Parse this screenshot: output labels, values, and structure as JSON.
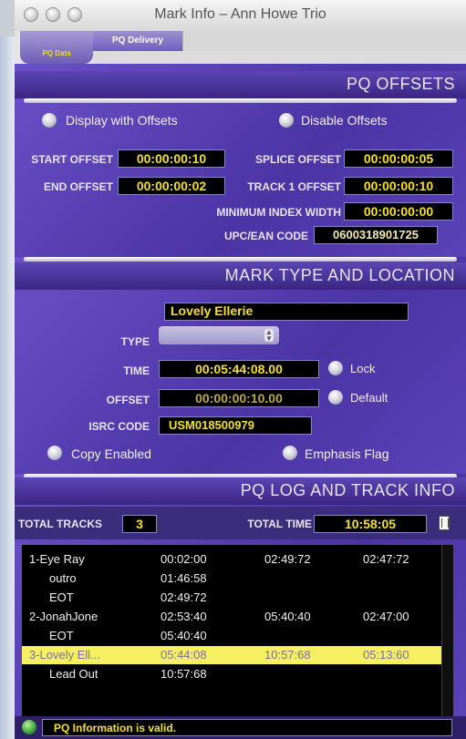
{
  "window": {
    "title": "Mark Info – Ann Howe Trio"
  },
  "tabs": {
    "active": "PQ Data",
    "second": "PQ Delivery"
  },
  "pq_offsets": {
    "header": "PQ OFFSETS",
    "display_with_offsets": "Display with Offsets",
    "disable_offsets": "Disable Offsets",
    "start_offset_label": "START OFFSET",
    "start_offset_value": "00:00:00:10",
    "splice_offset_label": "SPLICE OFFSET",
    "splice_offset_value": "00:00:00:05",
    "end_offset_label": "END OFFSET",
    "end_offset_value": "00:00:00:02",
    "track1_offset_label": "TRACK 1 OFFSET",
    "track1_offset_value": "00:00:00:10",
    "min_index_label": "MINIMUM INDEX WIDTH",
    "min_index_value": "00:00:00:00",
    "upc_label": "UPC/EAN CODE",
    "upc_value": "0600318901725"
  },
  "mark_type": {
    "header": "MARK TYPE AND LOCATION",
    "name": "Lovely Ellerie",
    "type_label": "TYPE",
    "time_label": "TIME",
    "time_value": "00:05:44:08.00",
    "lock_label": "Lock",
    "offset_label": "OFFSET",
    "offset_value": "00:00:00:10.00",
    "default_label": "Default",
    "isrc_label": "ISRC CODE",
    "isrc_value": "USM018500979",
    "copy_enabled": "Copy Enabled",
    "emphasis_flag": "Emphasis Flag"
  },
  "pq_log": {
    "header": "PQ LOG AND TRACK INFO",
    "total_tracks_label": "TOTAL TRACKS",
    "total_tracks_value": "3",
    "total_time_label": "TOTAL TIME",
    "total_time_value": "10:58:05",
    "rows": [
      {
        "c1": "1-Eye Ray",
        "c2": "00:02:00",
        "c3": "02:49:72",
        "c4": "02:47:72",
        "selected": false
      },
      {
        "c1": "outro",
        "c2": "01:46:58",
        "c3": "",
        "c4": "",
        "selected": false
      },
      {
        "c1": "EOT",
        "c2": "02:49:72",
        "c3": "",
        "c4": "",
        "selected": false
      },
      {
        "c1": "2-JonahJone",
        "c2": "02:53:40",
        "c3": "05:40:40",
        "c4": "02:47:00",
        "selected": false
      },
      {
        "c1": "EOT",
        "c2": "05:40:40",
        "c3": "",
        "c4": "",
        "selected": false
      },
      {
        "c1": "3-Lovely Ell...",
        "c2": "05:44:08",
        "c3": "10:57:68",
        "c4": "05:13:60",
        "selected": true
      },
      {
        "c1": "Lead Out",
        "c2": "10:57:68",
        "c3": "",
        "c4": "",
        "selected": false
      }
    ]
  },
  "status": {
    "message": "PQ Information is valid."
  }
}
